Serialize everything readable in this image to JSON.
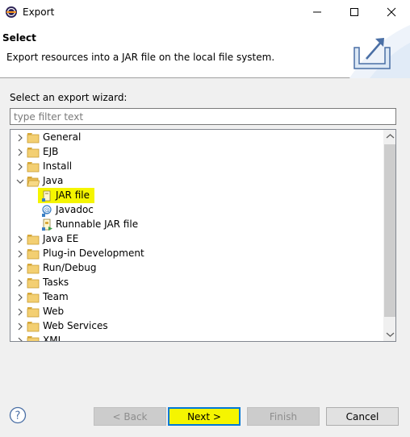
{
  "window": {
    "title": "Export"
  },
  "header": {
    "title": "Select",
    "description": "Export resources into a JAR file on the local file system."
  },
  "wizard": {
    "label": "Select an export wizard:",
    "filter_placeholder": "type filter text",
    "filter_value": ""
  },
  "tree": {
    "items": [
      {
        "label": "General",
        "expanded": false
      },
      {
        "label": "EJB",
        "expanded": false
      },
      {
        "label": "Install",
        "expanded": false
      },
      {
        "label": "Java",
        "expanded": true
      },
      {
        "label": "JAR file",
        "selected": true
      },
      {
        "label": "Javadoc"
      },
      {
        "label": "Runnable JAR file"
      },
      {
        "label": "Java EE",
        "expanded": false
      },
      {
        "label": "Plug-in Development",
        "expanded": false
      },
      {
        "label": "Run/Debug",
        "expanded": false
      },
      {
        "label": "Tasks",
        "expanded": false
      },
      {
        "label": "Team",
        "expanded": false
      },
      {
        "label": "Web",
        "expanded": false
      },
      {
        "label": "Web Services",
        "expanded": false
      },
      {
        "label": "XML",
        "expanded": false
      }
    ]
  },
  "buttons": {
    "back": "< Back",
    "next": "Next >",
    "finish": "Finish",
    "cancel": "Cancel"
  },
  "colors": {
    "highlight": "#f5f500",
    "focus": "#0078d7",
    "folder": "#e8c05a"
  }
}
